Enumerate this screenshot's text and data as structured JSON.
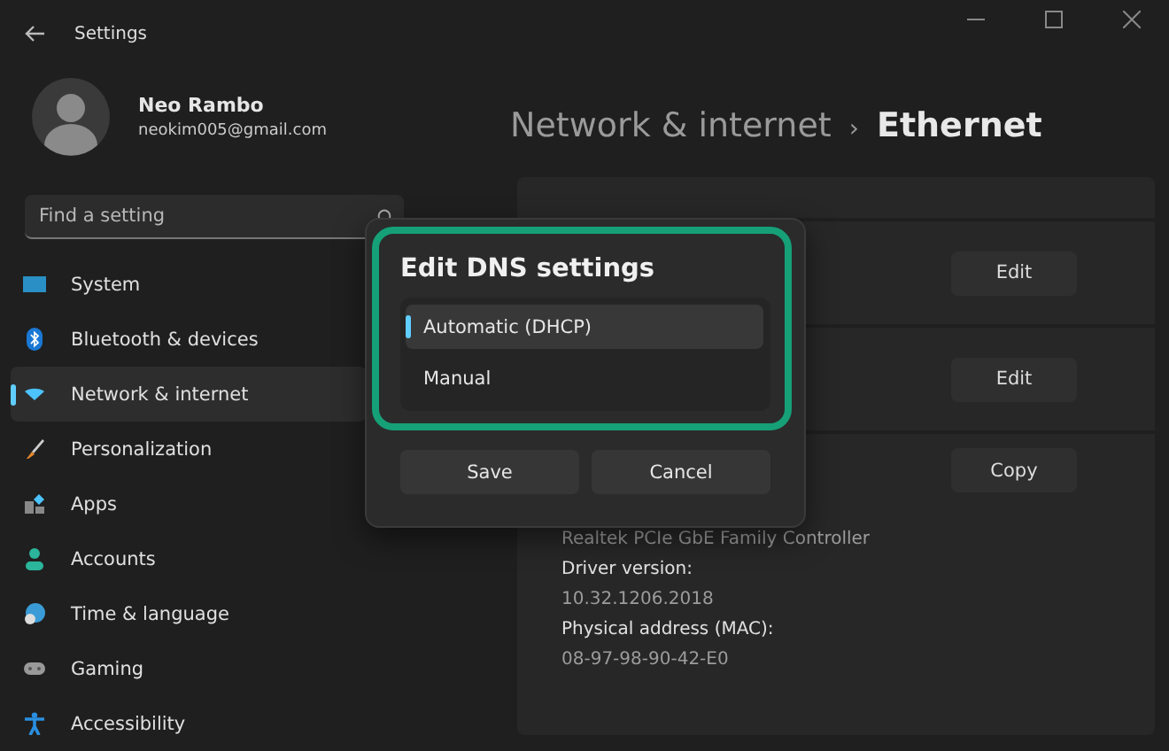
{
  "window": {
    "title": "Settings"
  },
  "profile": {
    "name": "Neo Rambo",
    "email": "neokim005@gmail.com"
  },
  "search": {
    "placeholder": "Find a setting"
  },
  "sidebar": {
    "items": [
      {
        "label": "System",
        "selected": false
      },
      {
        "label": "Bluetooth & devices",
        "selected": false
      },
      {
        "label": "Network & internet",
        "selected": true
      },
      {
        "label": "Personalization",
        "selected": false
      },
      {
        "label": "Apps",
        "selected": false
      },
      {
        "label": "Accounts",
        "selected": false
      },
      {
        "label": "Time & language",
        "selected": false
      },
      {
        "label": "Gaming",
        "selected": false
      },
      {
        "label": "Accessibility",
        "selected": false
      }
    ]
  },
  "page": {
    "breadcrumb": [
      "Network & internet",
      "Ethernet"
    ],
    "separator": "›"
  },
  "settings_rows": [
    {
      "button": "Edit"
    },
    {
      "button": "Edit"
    },
    {
      "button": "Copy"
    }
  ],
  "properties": [
    {
      "kind": "value",
      "text": "Realtek PCIe GbE Family Controller"
    },
    {
      "kind": "label",
      "text": "Driver version:"
    },
    {
      "kind": "value",
      "text": "10.32.1206.2018"
    },
    {
      "kind": "label",
      "text": "Physical address (MAC):"
    },
    {
      "kind": "value",
      "text": "08-97-98-90-42-E0"
    }
  ],
  "dialog": {
    "title": "Edit DNS settings",
    "options": [
      {
        "label": "Automatic (DHCP)",
        "selected": true
      },
      {
        "label": "Manual",
        "selected": false
      }
    ],
    "buttons": [
      "Save",
      "Cancel"
    ]
  }
}
